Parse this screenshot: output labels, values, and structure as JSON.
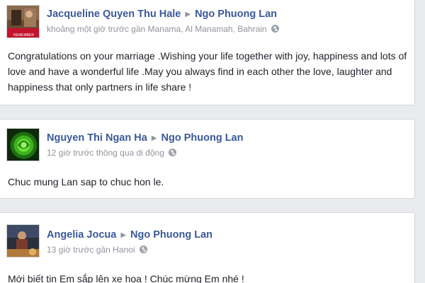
{
  "posts": [
    {
      "author": "Jacqueline Quyen Thu Hale",
      "target": "Ngo Phuong Lan",
      "meta": "khoảng một giờ trước gần Manama, Al Manamah, Bahrain",
      "text": "Congratulations on your marriage .Wishing your life together with joy, happiness and lots of love and have a wonderful life .May you always find in each other the love, laughter and happiness that only partners in life share !",
      "avatar_caption": "REMEMBER"
    },
    {
      "author": "Nguyen Thi Ngan Ha",
      "target": "Ngo Phuong Lan",
      "meta": "12 giờ trước thông qua di động",
      "text": "Chuc mung Lan sap to chuc hon le."
    },
    {
      "author": "Angelia Jocua",
      "target": "Ngo Phuong Lan",
      "meta": "13 giờ trước gần Hanoi",
      "text": "Mới biết tin Em sắp lên xe hoa ! Chúc mừng Em nhé !"
    }
  ],
  "colors": {
    "link": "#3b5998",
    "meta": "#90949c",
    "background": "#e9ebee"
  },
  "icons": {
    "arrow": "triangle-right-icon",
    "privacy": "globe-icon"
  }
}
